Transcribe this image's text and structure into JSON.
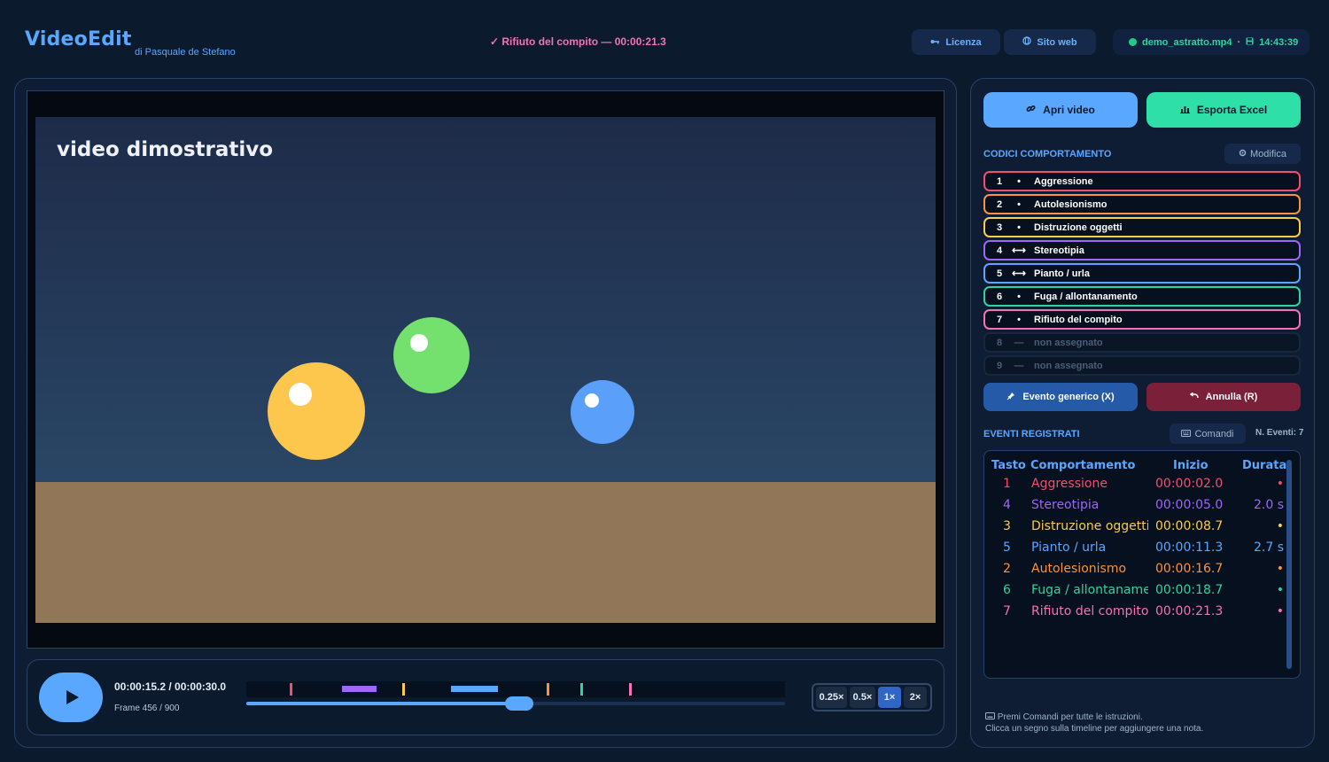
{
  "header": {
    "app_title": "VideoEdit",
    "byline": "di Pasquale de Stefano",
    "last_event": "✓ Rifiuto del compito — 00:00:21.3",
    "license_label": "Licenza",
    "website_label": "Sito web",
    "file_name": "demo_astratto.mp4",
    "separator": "·",
    "clock": "14:43:39"
  },
  "video": {
    "overlay_title": "video dimostrativo",
    "timecode": "00:00:15.2 / 00:00:30.0",
    "frame": "Frame 456 / 900",
    "progress": 0.507,
    "timeline_marks": [
      {
        "type": "tick",
        "at": 0.08,
        "color": "#f0506e"
      },
      {
        "type": "segment",
        "start": 0.178,
        "end": 0.242,
        "color": "#a066f5"
      },
      {
        "type": "tick",
        "at": 0.29,
        "color": "#facc4a"
      },
      {
        "type": "segment",
        "start": 0.38,
        "end": 0.467,
        "color": "#5aa7ff"
      },
      {
        "type": "tick",
        "at": 0.557,
        "color": "#fb923c"
      },
      {
        "type": "tick",
        "at": 0.62,
        "color": "#2dd4a0"
      },
      {
        "type": "tick",
        "at": 0.71,
        "color": "#f472b6"
      }
    ],
    "speeds": [
      {
        "label": "0.25×",
        "active": false
      },
      {
        "label": "0.5×",
        "active": false
      },
      {
        "label": "1×",
        "active": true
      },
      {
        "label": "2×",
        "active": false
      }
    ]
  },
  "sidebar": {
    "open_video_label": "Apri video",
    "export_excel_label": "Esporta Excel",
    "codes_title": "CODICI COMPORTAMENTO",
    "edit_label": "Modifica",
    "codes": [
      {
        "key": "1",
        "symbol": "•",
        "label": "Aggressione",
        "color": "#f0506e",
        "assigned": true
      },
      {
        "key": "2",
        "symbol": "•",
        "label": "Autolesionismo",
        "color": "#fb923c",
        "assigned": true
      },
      {
        "key": "3",
        "symbol": "•",
        "label": "Distruzione oggetti",
        "color": "#facc4a",
        "assigned": true
      },
      {
        "key": "4",
        "symbol": "⟷",
        "label": "Stereotipia",
        "color": "#a066f5",
        "assigned": true
      },
      {
        "key": "5",
        "symbol": "⟷",
        "label": "Pianto / urla",
        "color": "#5aa7ff",
        "assigned": true
      },
      {
        "key": "6",
        "symbol": "•",
        "label": "Fuga / allontanamento",
        "color": "#2dd4a0",
        "assigned": true
      },
      {
        "key": "7",
        "symbol": "•",
        "label": "Rifiuto del compito",
        "color": "#f472b6",
        "assigned": true
      },
      {
        "key": "8",
        "symbol": "—",
        "label": "non assegnato",
        "color": "#16273f",
        "assigned": false
      },
      {
        "key": "9",
        "symbol": "—",
        "label": "non assegnato",
        "color": "#16273f",
        "assigned": false
      }
    ],
    "generic_event_label": "Evento generico (X)",
    "undo_label": "Annulla (R)",
    "events_title": "EVENTI REGISTRATI",
    "commands_label": "Comandi",
    "events_count": "N. Eventi: 7",
    "events_headers": {
      "key": "Tasto",
      "behavior": "Comportamento",
      "start": "Inizio",
      "duration": "Durata"
    },
    "events": [
      {
        "key": "1",
        "behavior": "Aggressione",
        "start": "00:00:02.0",
        "duration": "•",
        "color": "#f0506e"
      },
      {
        "key": "4",
        "behavior": "Stereotipia",
        "start": "00:00:05.0",
        "duration": "2.0 s",
        "color": "#a066f5"
      },
      {
        "key": "3",
        "behavior": "Distruzione oggetti",
        "start": "00:00:08.7",
        "duration": "•",
        "color": "#facc4a"
      },
      {
        "key": "5",
        "behavior": "Pianto / urla",
        "start": "00:00:11.3",
        "duration": "2.7 s",
        "color": "#5aa7ff"
      },
      {
        "key": "2",
        "behavior": "Autolesionismo",
        "start": "00:00:16.7",
        "duration": "•",
        "color": "#fb923c"
      },
      {
        "key": "6",
        "behavior": "Fuga / allontanamento",
        "start": "00:00:18.7",
        "duration": "•",
        "color": "#2dd4a0"
      },
      {
        "key": "7",
        "behavior": "Rifiuto del compito",
        "start": "00:00:21.3",
        "duration": "•",
        "color": "#f472b6"
      }
    ],
    "footnote_line1": "Premi Comandi per tutte le istruzioni.",
    "footnote_line2": "Clicca un segno sulla timeline per aggiungere una nota."
  },
  "colors": {
    "accent": "#5aa7ff",
    "export": "#2ee0a8",
    "undo": "#7a2038",
    "generic": "#245aa8"
  }
}
